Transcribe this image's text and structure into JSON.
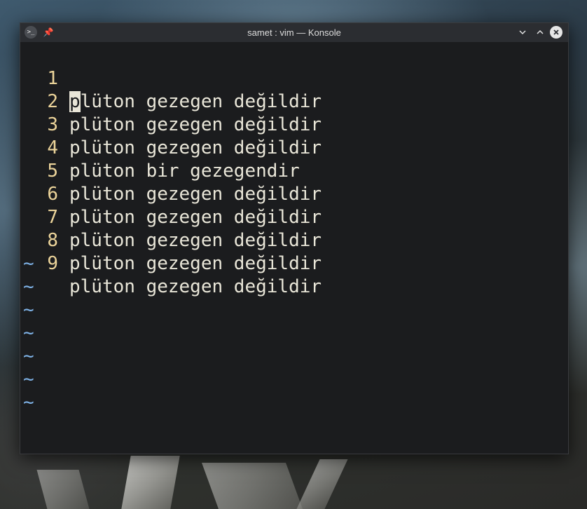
{
  "window": {
    "title": "samet : vim — Konsole",
    "app_icon": "konsole-icon",
    "pin_icon": "pin-icon",
    "minimize_icon": "chevron-down-icon",
    "maximize_icon": "chevron-up-icon",
    "close_icon": "close-icon"
  },
  "editor": {
    "cursor": {
      "line": 1,
      "column": 1
    },
    "lines": [
      {
        "number": "1",
        "first_char": "p",
        "rest": "lüton gezegen değildir"
      },
      {
        "number": "2",
        "text": "plüton gezegen değildir"
      },
      {
        "number": "3",
        "text": "plüton gezegen değildir"
      },
      {
        "number": "4",
        "text": "plüton bir gezegendir"
      },
      {
        "number": "5",
        "text": "plüton gezegen değildir"
      },
      {
        "number": "6",
        "text": "plüton gezegen değildir"
      },
      {
        "number": "7",
        "text": "plüton gezegen değildir"
      },
      {
        "number": "8",
        "text": "plüton gezegen değildir"
      },
      {
        "number": "9",
        "text": "plüton gezegen değildir"
      }
    ],
    "empty_line_marker": "~",
    "empty_line_count": 7
  },
  "colors": {
    "line_number": "#ecd49a",
    "text": "#e9e6d8",
    "tilde": "#7fb3e8",
    "background": "#1b1c1e"
  }
}
